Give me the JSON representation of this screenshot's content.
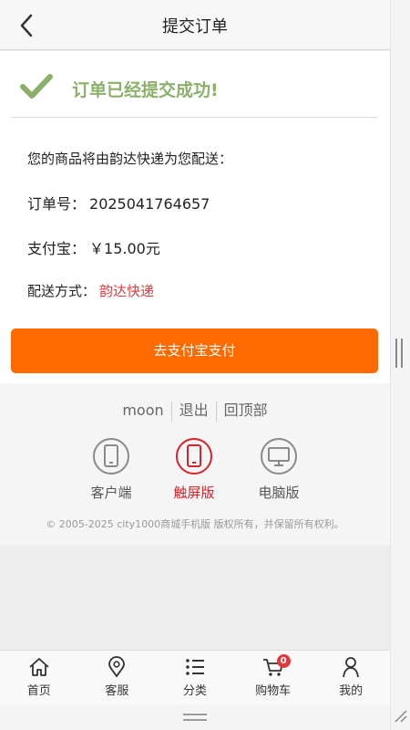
{
  "header": {
    "title": "提交订单",
    "back_icon": "chevron-left-icon"
  },
  "success": {
    "icon": "checkmark-icon",
    "message": "订单已经提交成功!",
    "color": "#8cb06a"
  },
  "order": {
    "delivery_note": "您的商品将由韵达快递为您配送：",
    "order_no_label": "订单号：",
    "order_no": "2025041764657",
    "pay_label": "支付宝：",
    "amount": "￥15.00元",
    "shipping_label": "配送方式：",
    "shipping_method": "韵达快递"
  },
  "pay_button": {
    "label": "去支付宝支付",
    "color": "#ff6a00"
  },
  "footer": {
    "links": [
      "moon",
      "退出",
      "回顶部"
    ],
    "versions": [
      {
        "label": "客户端",
        "icon": "phone-icon",
        "active": false
      },
      {
        "label": "触屏版",
        "icon": "touch-phone-icon",
        "active": true
      },
      {
        "label": "电脑版",
        "icon": "monitor-icon",
        "active": false
      }
    ],
    "copyright": "© 2005-2025 city1000商城手机版 版权所有，并保留所有权利。"
  },
  "tabbar": {
    "items": [
      {
        "label": "首页",
        "icon": "home-icon"
      },
      {
        "label": "客服",
        "icon": "location-pin-icon"
      },
      {
        "label": "分类",
        "icon": "list-icon"
      },
      {
        "label": "购物车",
        "icon": "cart-icon",
        "badge": "0"
      },
      {
        "label": "我的",
        "icon": "user-icon"
      }
    ]
  },
  "accent_red": "#e4393c"
}
